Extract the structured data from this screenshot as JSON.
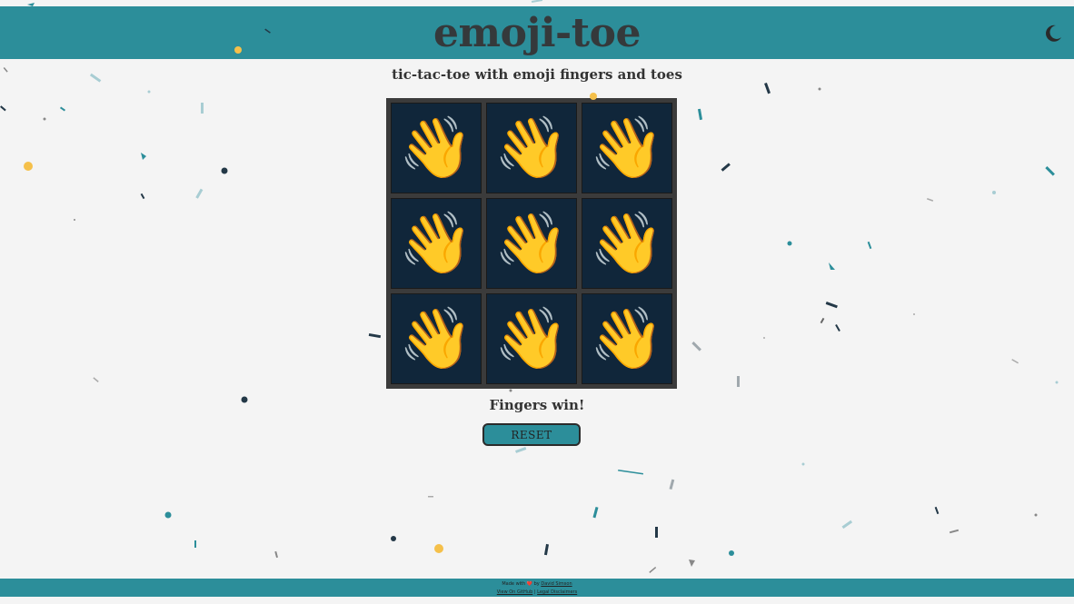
{
  "header": {
    "title": "emoji-toe",
    "theme_toggle_icon": "moon-icon"
  },
  "subtitle": "tic-tac-toe with emoji fingers and toes",
  "board": {
    "cells": [
      "👋",
      "👋",
      "👋",
      "👋",
      "👋",
      "👋",
      "👋",
      "👋",
      "👋"
    ]
  },
  "status": "Fingers win!",
  "reset_label": "RESET",
  "footer": {
    "made_with": "Made with",
    "heart": "❤️",
    "by": "by",
    "author": "David Simson",
    "github_link": "View On GitHub",
    "separator": "|",
    "legal_link": "Legal Disclaimers"
  },
  "colors": {
    "header_bg": "#2c8e9a",
    "board_border": "#3b3b3b",
    "cell_bg": "#10263a",
    "page_bg": "#f4f4f4"
  }
}
